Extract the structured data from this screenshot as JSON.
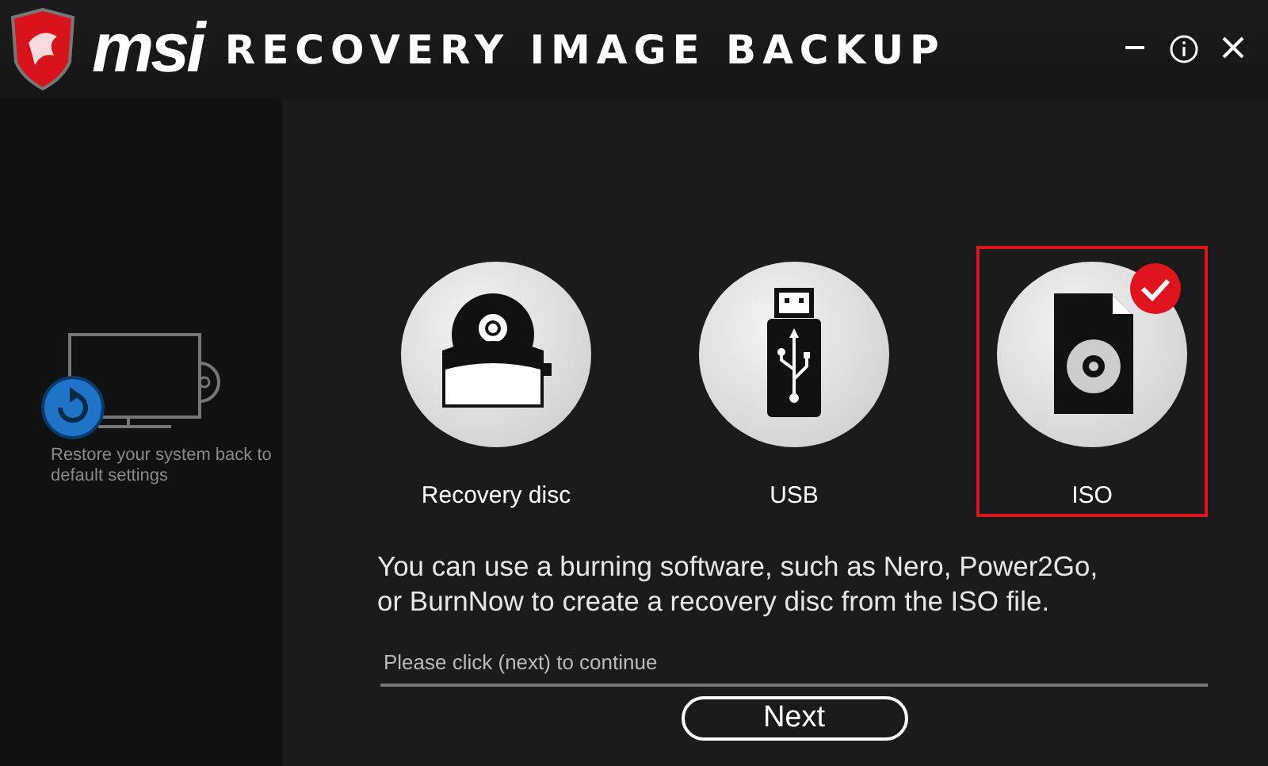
{
  "header": {
    "logo": "msi",
    "title": "RECOVERY IMAGE BACKUP"
  },
  "sidebar": {
    "caption": "Restore your system back to default settings"
  },
  "options": [
    {
      "kind": "disc",
      "label": "Recovery disc",
      "selected": false
    },
    {
      "kind": "usb",
      "label": "USB",
      "selected": false
    },
    {
      "kind": "iso",
      "label": "ISO",
      "selected": true
    }
  ],
  "description": "You can use a burning software, such as Nero, Power2Go, or BurnNow to create a recovery disc from the ISO file.",
  "hint": "Please click (next) to continue",
  "buttons": [
    "Next"
  ]
}
